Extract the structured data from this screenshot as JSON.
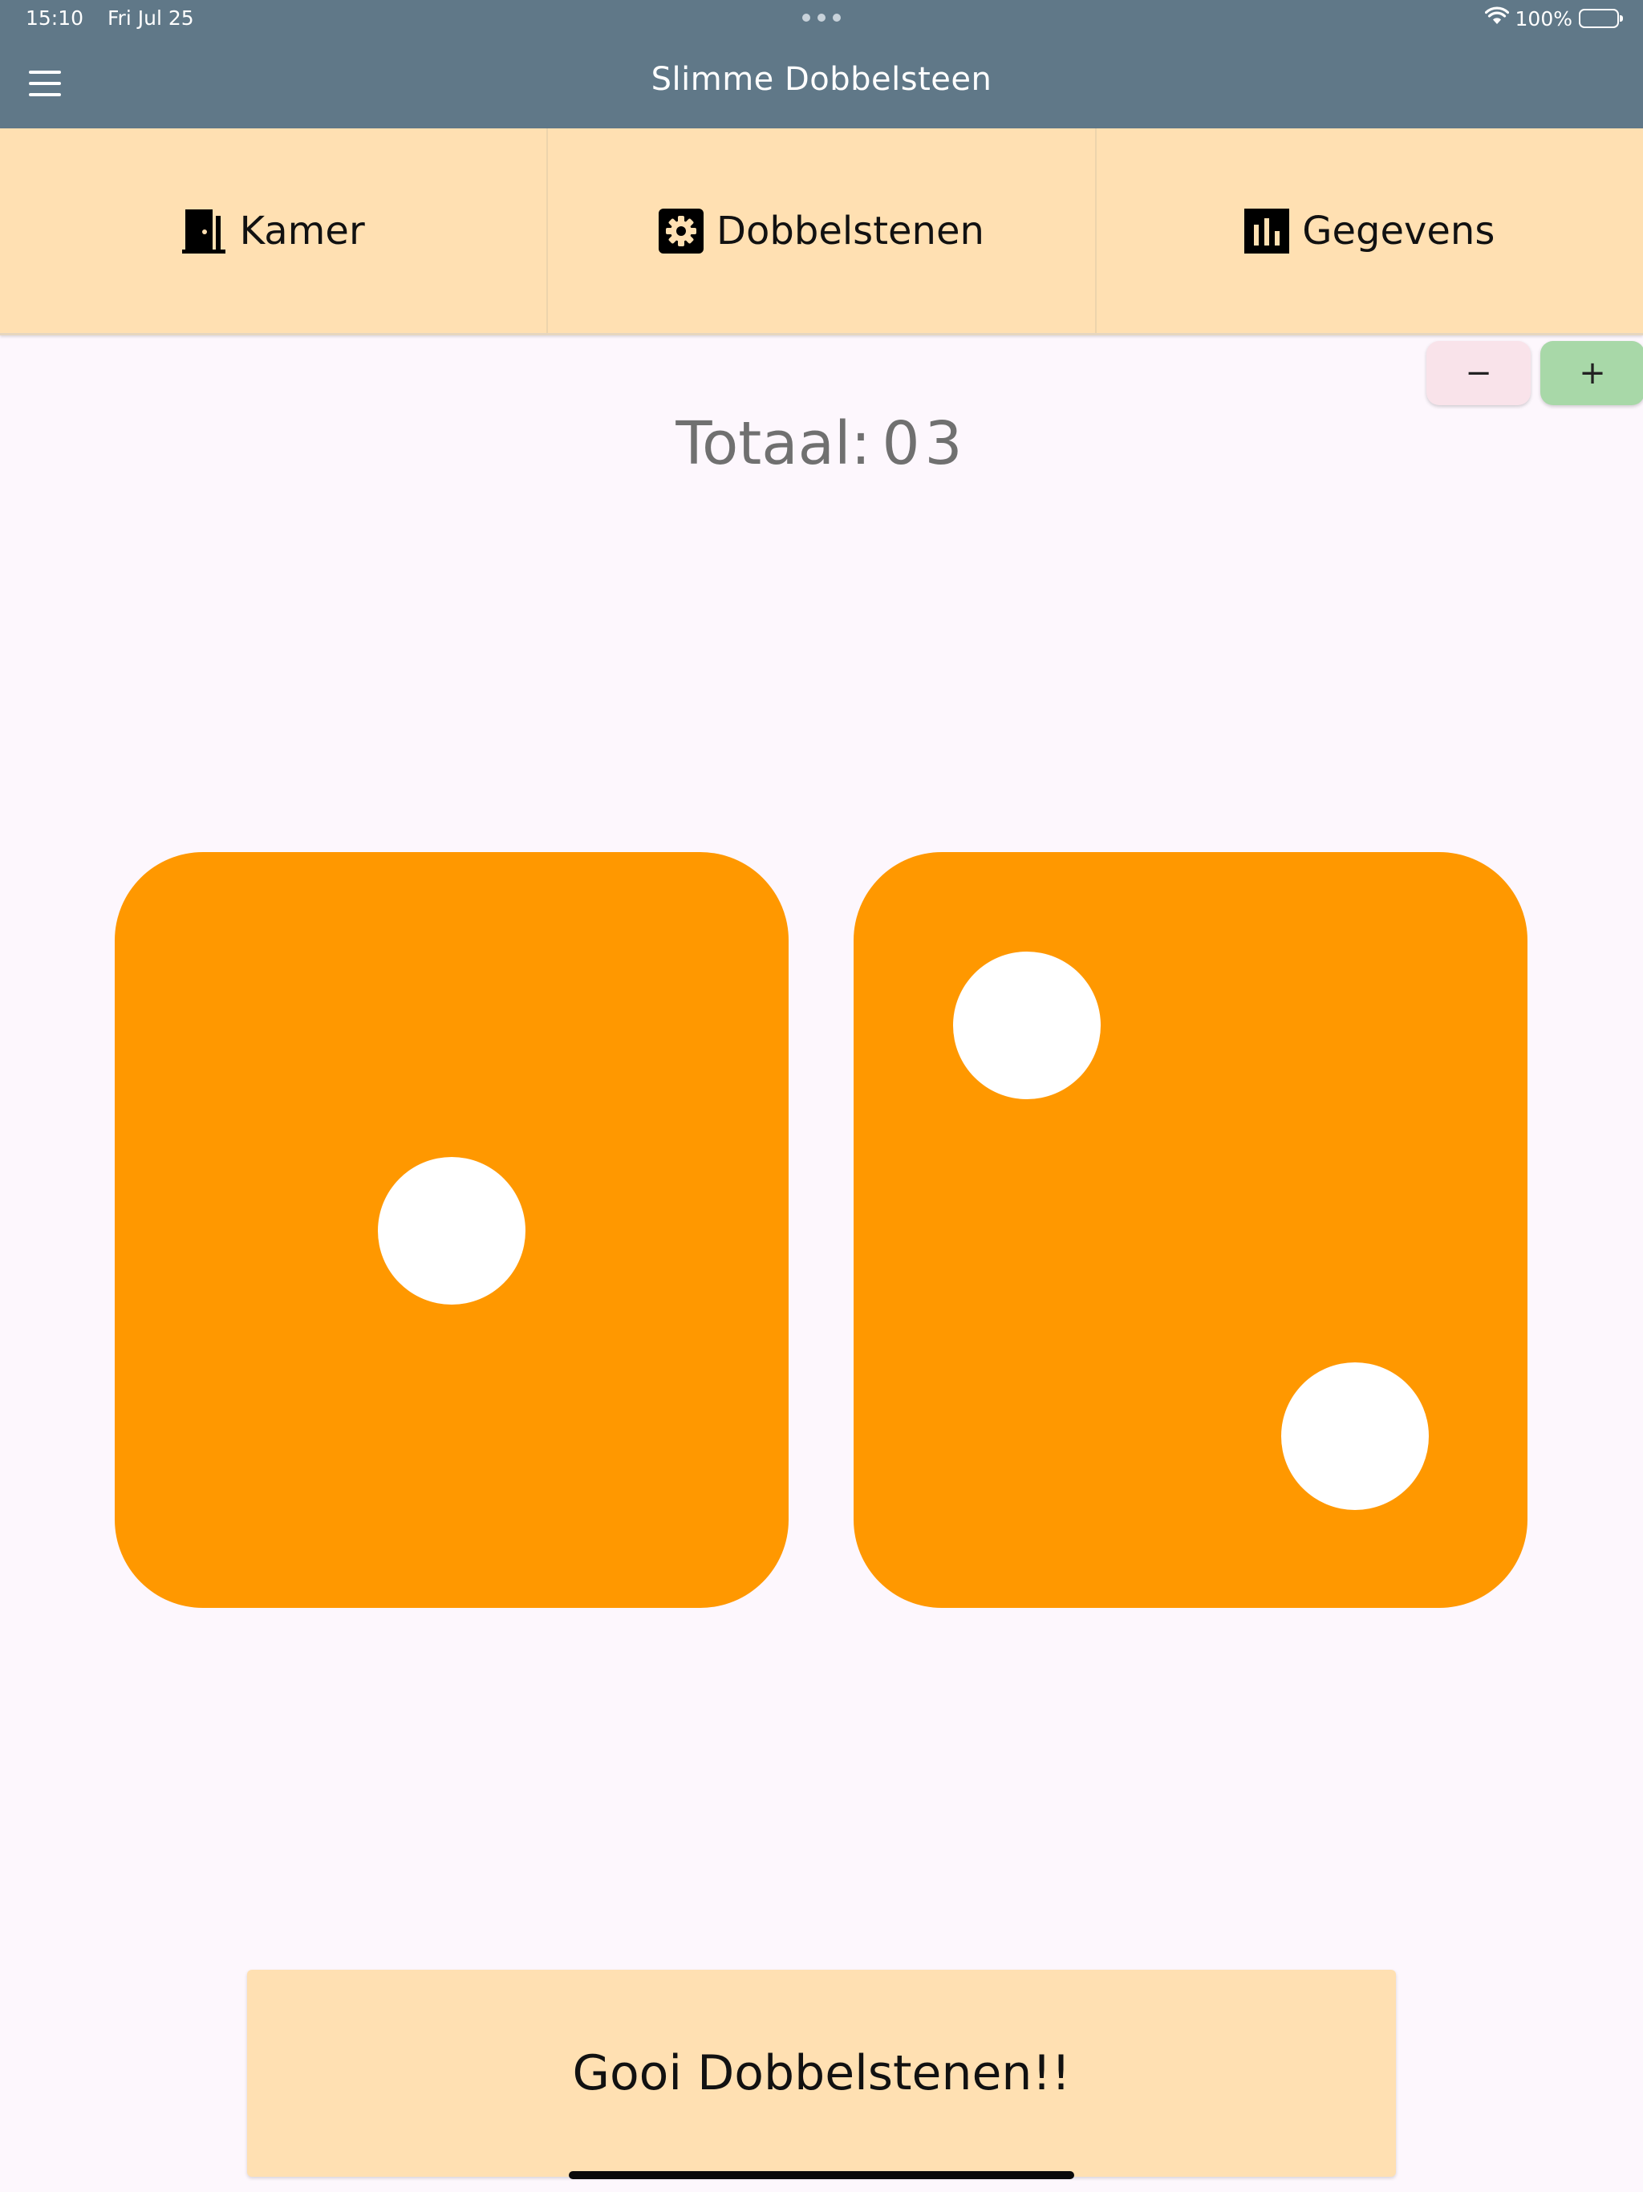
{
  "status_bar": {
    "time": "15:10",
    "date": "Fri Jul 25",
    "battery": "100%"
  },
  "app_bar": {
    "title": "Slimme Dobbelsteen"
  },
  "tabs": [
    {
      "label": "Kamer",
      "icon": "door-icon"
    },
    {
      "label": "Dobbelstenen",
      "icon": "settings-gear-icon"
    },
    {
      "label": "Gegevens",
      "icon": "bar-chart-icon"
    }
  ],
  "stepper": {
    "minus_label": "−",
    "plus_label": "+"
  },
  "total": {
    "label": "Totaal:",
    "value": "03"
  },
  "dice": [
    {
      "value": 1,
      "color": "#ff9800"
    },
    {
      "value": 2,
      "color": "#ff9800"
    }
  ],
  "roll_button": {
    "label": "Gooi Dobbelstenen!!"
  },
  "colors": {
    "app_bar": "#607888",
    "tab_bar": "#ffe0b2",
    "background": "#fdf7fd",
    "die": "#ff9800",
    "pip": "#ffffff",
    "minus_button": "#f9e3ea",
    "plus_button": "#a8d8a8"
  }
}
